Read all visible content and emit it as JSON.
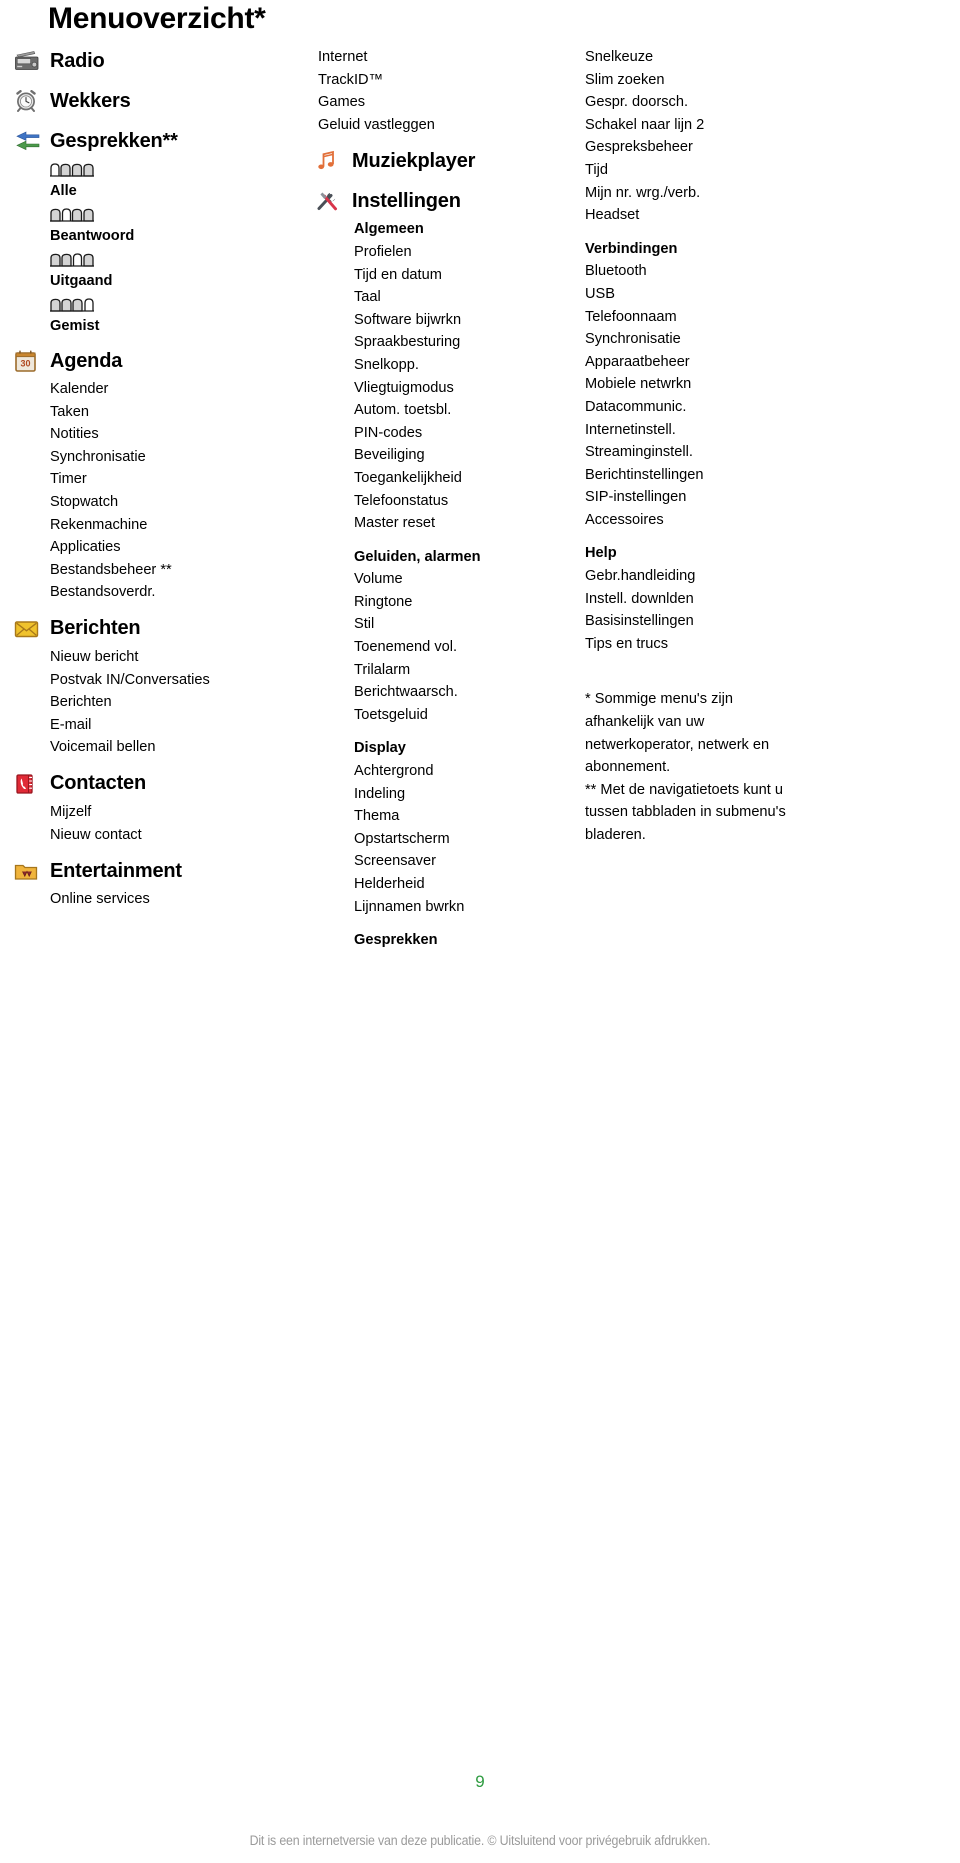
{
  "page": {
    "title": "Menuoverzicht*",
    "number": "9",
    "disclaimer": "Dit is een internetversie van deze publicatie. © Uitsluitend voor privégebruik afdrukken.",
    "accent_green": "#2e9b40",
    "disclaimer_color": "#9b9b9b"
  },
  "left_column": {
    "sections": [
      {
        "icon": "radio-icon",
        "label": "Radio",
        "items": []
      },
      {
        "icon": "alarm-clock-icon",
        "label": "Wekkers",
        "items": []
      },
      {
        "icon": "calls-arrows-icon",
        "label": "Gesprekken**",
        "tab_items": [
          {
            "icon": "call-tab-all-icon",
            "label": "Alle"
          },
          {
            "icon": "call-tab-answered-icon",
            "label": "Beantwoord"
          },
          {
            "icon": "call-tab-outgoing-icon",
            "label": "Uitgaand"
          },
          {
            "icon": "call-tab-missed-icon",
            "label": "Gemist"
          }
        ]
      },
      {
        "icon": "calendar-icon",
        "label": "Agenda",
        "items": [
          "Kalender",
          "Taken",
          "Notities",
          "Synchronisatie",
          "Timer",
          "Stopwatch",
          "Rekenmachine",
          "Applicaties",
          "Bestandsbeheer **",
          "Bestandsoverdr."
        ]
      },
      {
        "icon": "envelope-icon",
        "label": "Berichten",
        "items": [
          "Nieuw bericht",
          "Postvak IN/Conversaties",
          "Berichten",
          "E-mail",
          "Voicemail bellen"
        ]
      },
      {
        "icon": "contacts-book-icon",
        "label": "Contacten",
        "items": [
          "Mijzelf",
          "Nieuw contact"
        ]
      },
      {
        "icon": "entertainment-folder-icon",
        "label": "Entertainment",
        "items": [
          "Online services"
        ]
      }
    ]
  },
  "middle_column": {
    "top_items": [
      "Internet",
      "TrackID™",
      "Games",
      "Geluid vastleggen"
    ],
    "sections": [
      {
        "icon": "music-note-icon",
        "label": "Muziekplayer",
        "groups": []
      },
      {
        "icon": "tools-icon",
        "label": "Instellingen",
        "groups": [
          {
            "head": "Algemeen",
            "items": [
              "Profielen",
              "Tijd en datum",
              "Taal",
              "Software bijwrkn",
              "Spraakbesturing",
              "Snelkopp.",
              "Vliegtuigmodus",
              "Autom. toetsbl.",
              "PIN-codes",
              "Beveiliging",
              "Toegankelijkheid",
              "Telefoonstatus",
              "Master reset"
            ]
          },
          {
            "head": "Geluiden, alarmen",
            "items": [
              "Volume",
              "Ringtone",
              "Stil",
              "Toenemend vol.",
              "Trilalarm",
              "Berichtwaarsch.",
              "Toetsgeluid"
            ]
          },
          {
            "head": "Display",
            "items": [
              "Achtergrond",
              "Indeling",
              "Thema",
              "Opstartscherm",
              "Screensaver",
              "Helderheid",
              "Lijnnamen bwrkn"
            ]
          },
          {
            "head": "Gesprekken",
            "items": []
          }
        ]
      }
    ]
  },
  "right_column": {
    "groups": [
      {
        "head": "",
        "items": [
          "Snelkeuze",
          "Slim zoeken",
          "Gespr. doorsch.",
          "Schakel naar lijn 2",
          "Gespreksbeheer",
          "Tijd",
          "Mijn nr. wrg./verb.",
          "Headset"
        ]
      },
      {
        "head": "Verbindingen",
        "items": [
          "Bluetooth",
          "USB",
          "Telefoonnaam",
          "Synchronisatie",
          "Apparaatbeheer",
          "Mobiele netwrkn",
          "Datacommunic.",
          "Internetinstell.",
          "Streaminginstell.",
          "Berichtinstellingen",
          "SIP-instellingen",
          "Accessoires"
        ]
      },
      {
        "head": "Help",
        "items": [
          "Gebr.handleiding",
          "Instell. downlden",
          "Basisinstellingen",
          "Tips en trucs"
        ]
      }
    ],
    "footnotes": [
      "* Sommige menu's zijn",
      "afhankelijk van uw",
      "netwerkoperator, netwerk en",
      "abonnement.",
      "** Met de navigatietoets kunt u",
      "tussen tabbladen in submenu's",
      "bladeren."
    ]
  }
}
